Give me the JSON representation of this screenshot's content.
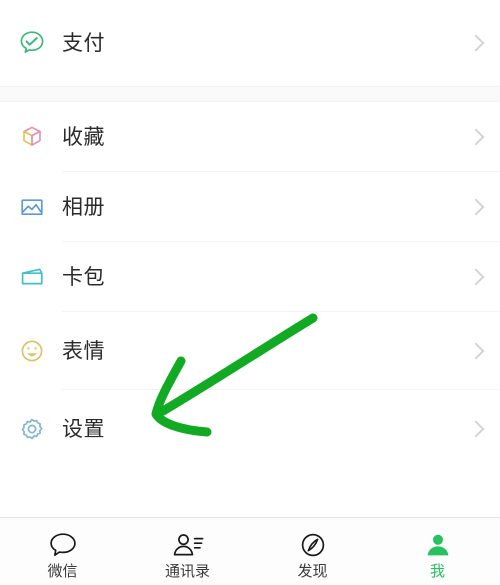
{
  "app": {
    "name": "WeChat",
    "screen": "me-profile-menu",
    "accent_color": "#27c160",
    "background_color": "#ffffff",
    "separator_color": "#f4f4f4"
  },
  "menu": {
    "groups": [
      {
        "items": [
          {
            "label": "支付",
            "icon": "wechat-pay-icon",
            "icon_color": "#3cb878",
            "chevron": "chevron-right-icon"
          }
        ]
      },
      {
        "items": [
          {
            "label": "收藏",
            "icon": "favorites-cube-icon",
            "icon_color": "#e9a0c0",
            "chevron": "chevron-right-icon"
          },
          {
            "label": "相册",
            "icon": "album-photo-icon",
            "icon_color": "#5a9bd5",
            "chevron": "chevron-right-icon"
          },
          {
            "label": "卡包",
            "icon": "card-wallet-icon",
            "icon_color": "#3fc1c9",
            "chevron": "chevron-right-icon"
          },
          {
            "label": "表情",
            "icon": "emoji-smiley-icon",
            "icon_color": "#e0c068",
            "chevron": "chevron-right-icon"
          },
          {
            "label": "设置",
            "icon": "settings-gear-icon",
            "icon_color": "#7fb4d6",
            "chevron": "chevron-right-icon"
          }
        ]
      }
    ]
  },
  "annotation": {
    "type": "hand-drawn-arrow",
    "color": "#12aa22",
    "points_to": "设置",
    "stroke_width": 9
  },
  "tabbar": {
    "active_index": 3,
    "active_color": "#27c160",
    "inactive_color": "#3b3b3b",
    "tabs": [
      {
        "label": "微信",
        "icon": "chat-bubble-icon"
      },
      {
        "label": "通讯录",
        "icon": "contacts-person-icon"
      },
      {
        "label": "发现",
        "icon": "discover-compass-icon"
      },
      {
        "label": "我",
        "icon": "me-person-icon"
      }
    ]
  }
}
